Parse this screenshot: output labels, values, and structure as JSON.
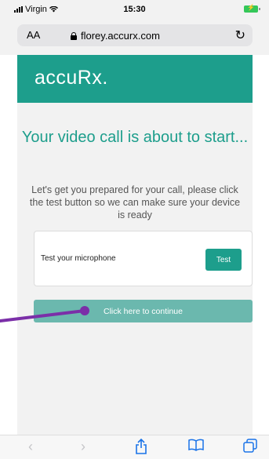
{
  "status_bar": {
    "carrier": "Virgin",
    "time": "15:30",
    "battery_color": "#34c759"
  },
  "browser": {
    "text_size_label": "AA",
    "url": "florey.accurx.com",
    "reload_icon": "reload-icon",
    "lock_icon": "lock-icon"
  },
  "header": {
    "logo": "accuRx.",
    "background": "#1d9e8c"
  },
  "main": {
    "title": "Your video call is about to start...",
    "description": "Let's get you prepared for your call, please click the test button so we can make sure your device is ready",
    "mic_label": "Test your microphone",
    "test_button": "Test",
    "continue_button": "Click here to continue"
  },
  "annotation": {
    "color": "#7b2fa8"
  },
  "toolbar": {
    "items": [
      "back-icon",
      "forward-icon",
      "share-icon",
      "bookmarks-icon",
      "tabs-icon"
    ],
    "accent": "#1a73e8"
  }
}
